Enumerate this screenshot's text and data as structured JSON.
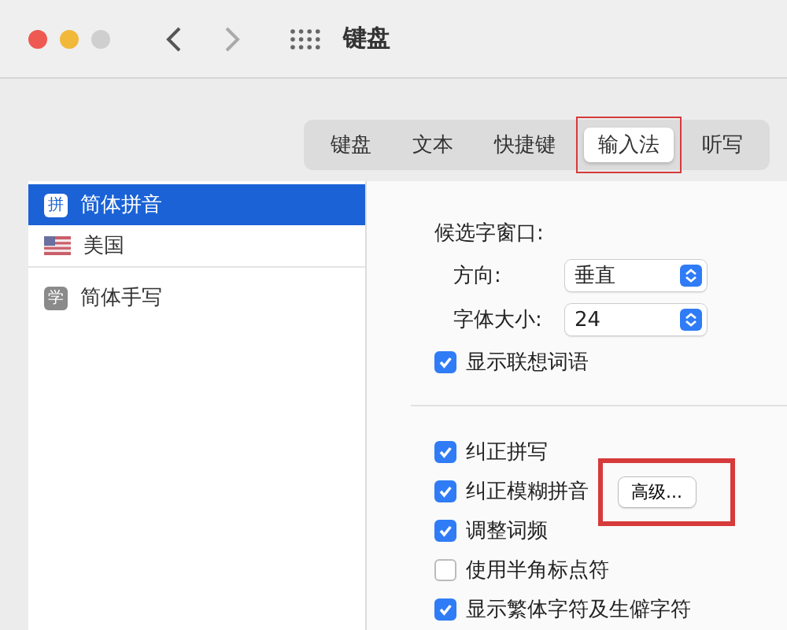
{
  "window": {
    "title": "键盘"
  },
  "tabs": [
    {
      "label": "键盘",
      "selected": false,
      "highlighted": false
    },
    {
      "label": "文本",
      "selected": false,
      "highlighted": false
    },
    {
      "label": "快捷键",
      "selected": false,
      "highlighted": false
    },
    {
      "label": "输入法",
      "selected": true,
      "highlighted": true
    },
    {
      "label": "听写",
      "selected": false,
      "highlighted": false
    }
  ],
  "sources": [
    {
      "label": "简体拼音",
      "icon_text": "拼",
      "kind": "glyph",
      "selected": true
    },
    {
      "label": "美国",
      "kind": "flag",
      "selected": false
    },
    {
      "label": "简体手写",
      "icon_text": "学",
      "kind": "glyph",
      "selected": false
    }
  ],
  "candidate_window": {
    "heading": "候选字窗口:",
    "fields": [
      {
        "label": "方向:",
        "value": "垂直"
      },
      {
        "label": "字体大小:",
        "value": "24"
      }
    ],
    "option": {
      "label": "显示联想词语",
      "checked": true
    }
  },
  "options": [
    {
      "label": "纠正拼写",
      "checked": true
    },
    {
      "label": "纠正模糊拼音",
      "checked": true,
      "button": {
        "label": "高级...",
        "highlighted": true
      }
    },
    {
      "label": "调整词频",
      "checked": true
    },
    {
      "label": "使用半角标点符",
      "checked": false
    },
    {
      "label": "显示繁体字符及生僻字符",
      "checked": true
    }
  ]
}
